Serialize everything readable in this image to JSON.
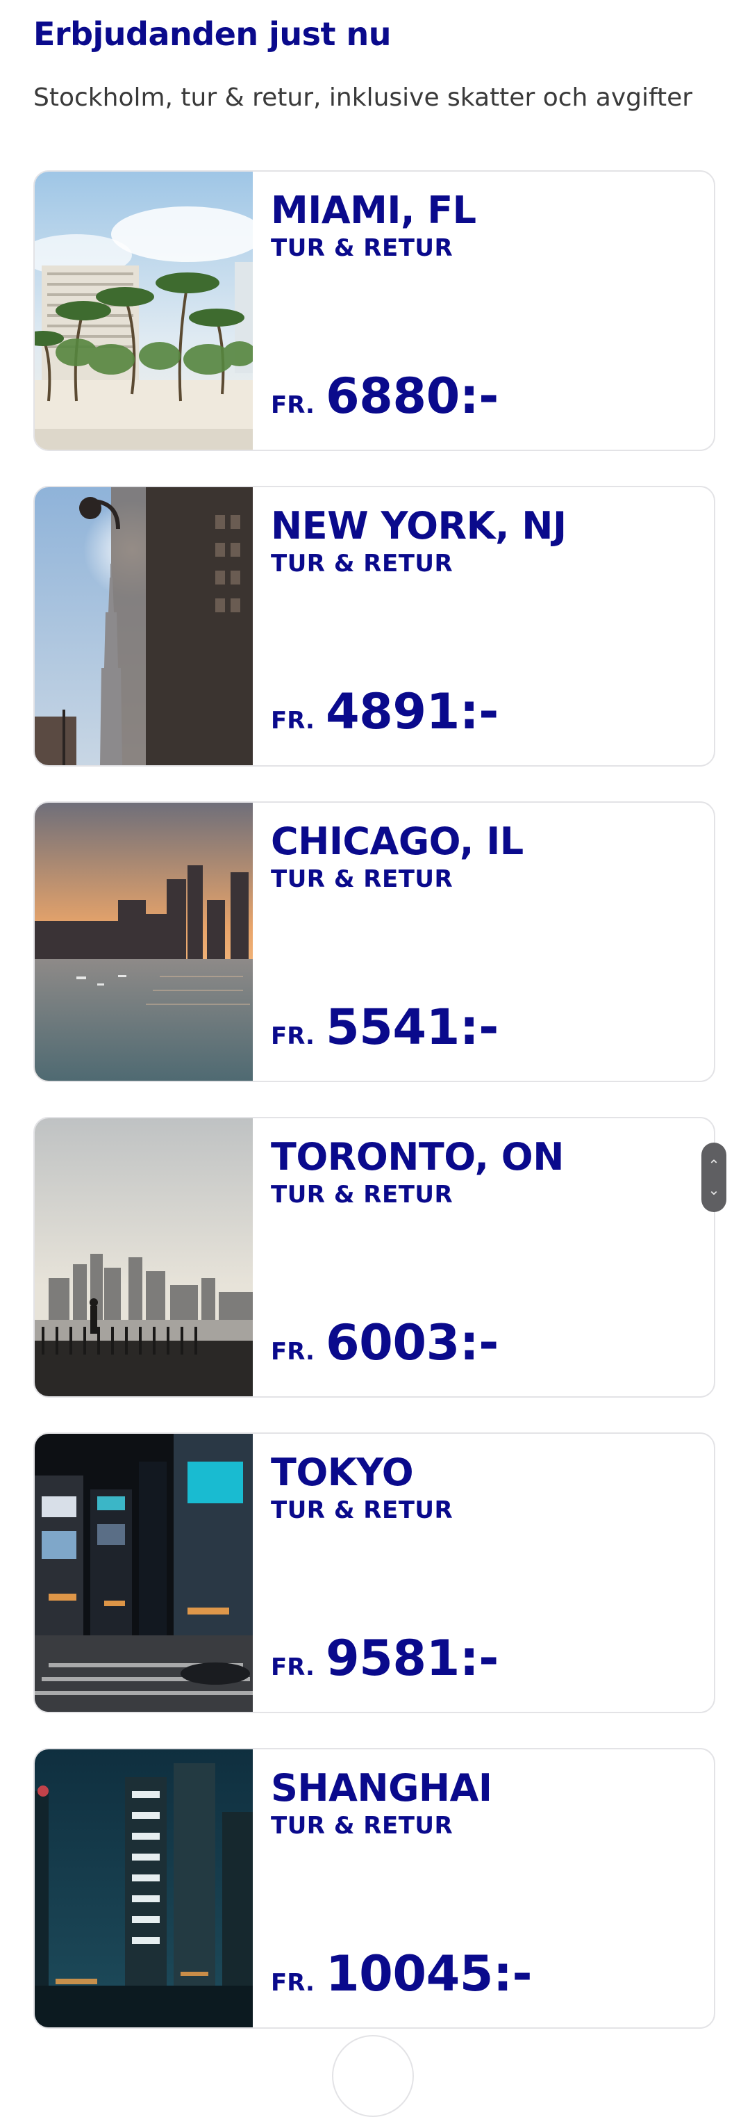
{
  "header": {
    "title": "Erbjudanden just nu",
    "subtitle": "Stockholm, tur & retur, inklusive skatter och avgifter"
  },
  "deals": [
    {
      "city": "MIAMI, FL",
      "trip": "TUR & RETUR",
      "from": "FR.",
      "price": "6880:-",
      "image": "miami-beach-palm-trees-photo"
    },
    {
      "city": "NEW YORK, NJ",
      "trip": "TUR & RETUR",
      "from": "FR.",
      "price": "4891:-",
      "image": "new-york-empire-state-photo"
    },
    {
      "city": "CHICAGO, IL",
      "trip": "TUR & RETUR",
      "from": "FR.",
      "price": "5541:-",
      "image": "chicago-skyline-sunset-photo"
    },
    {
      "city": "TORONTO, ON",
      "trip": "TUR & RETUR",
      "from": "FR.",
      "price": "6003:-",
      "image": "toronto-skyline-waterfront-photo"
    },
    {
      "city": "TOKYO",
      "trip": "TUR & RETUR",
      "from": "FR.",
      "price": "9581:-",
      "image": "tokyo-night-street-photo"
    },
    {
      "city": "SHANGHAI",
      "trip": "TUR & RETUR",
      "from": "FR.",
      "price": "10045:-",
      "image": "shanghai-night-skyline-photo"
    }
  ],
  "scroll_widget": {
    "up_icon": "chevron-up-icon",
    "down_icon": "chevron-down-icon"
  },
  "colors": {
    "brand": "#0a0a8c",
    "subtitle_text": "#3a3a3a",
    "card_border": "#e3e3e6",
    "scroll_widget": "#5f5f62"
  }
}
